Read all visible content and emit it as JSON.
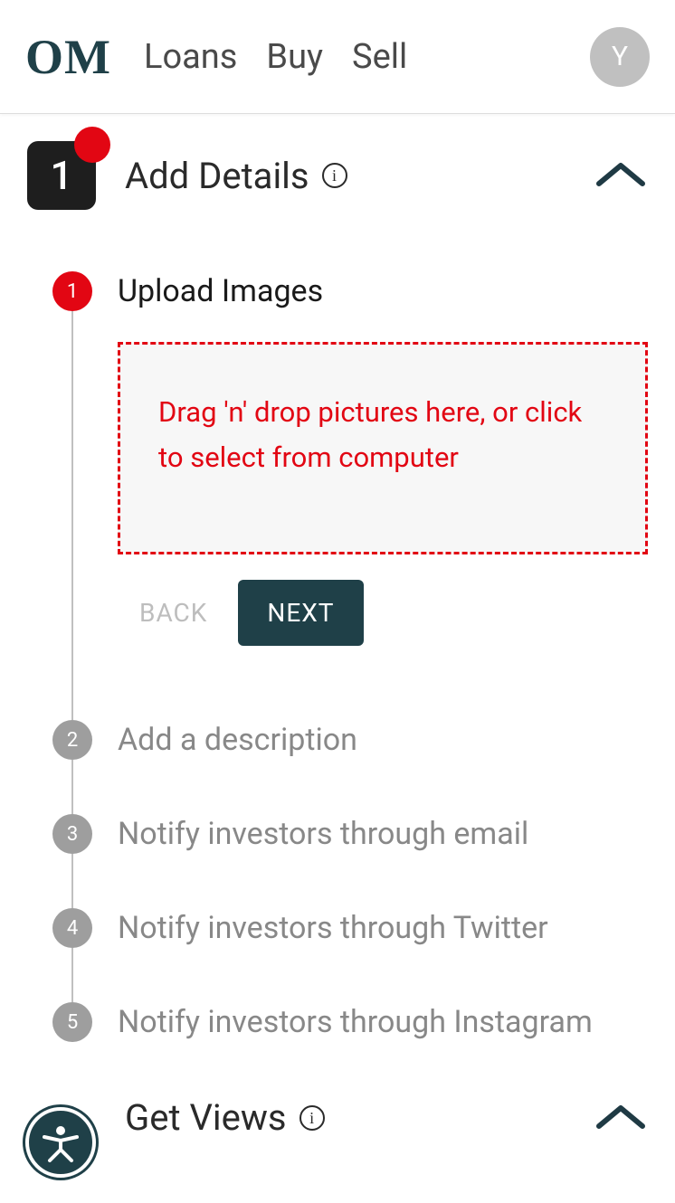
{
  "header": {
    "logo": "OM",
    "nav": [
      "Loans",
      "Buy",
      "Sell"
    ],
    "avatar_initial": "Y"
  },
  "section1": {
    "badge": "1",
    "title": "Add Details"
  },
  "steps": [
    {
      "number": "1",
      "title": "Upload Images",
      "active": true,
      "dropzone_text": "Drag 'n' drop pictures here, or click to select from computer",
      "back_label": "BACK",
      "next_label": "NEXT"
    },
    {
      "number": "2",
      "title": "Add a description",
      "active": false
    },
    {
      "number": "3",
      "title": "Notify investors through email",
      "active": false
    },
    {
      "number": "4",
      "title": "Notify investors through Twitter",
      "active": false
    },
    {
      "number": "5",
      "title": "Notify investors through Instagram",
      "active": false
    }
  ],
  "section2": {
    "title": "Get Views"
  },
  "colors": {
    "brand": "#1f4048",
    "accent": "#e20613",
    "muted": "#9e9e9e"
  }
}
